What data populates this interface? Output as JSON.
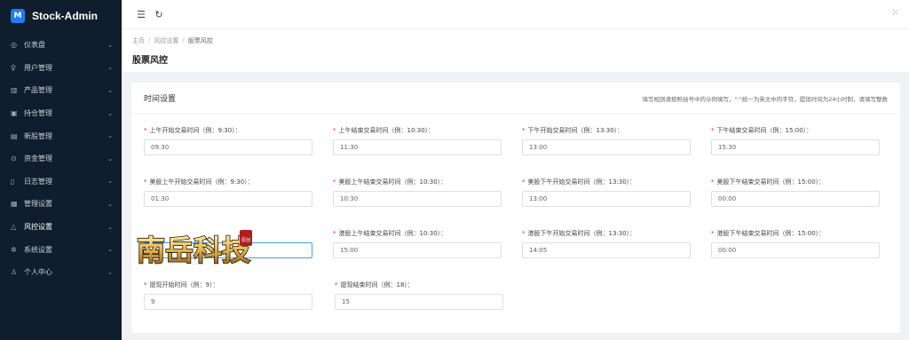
{
  "app": {
    "title": "Stock-Admin",
    "logo_glyph": "M"
  },
  "sidebar": {
    "items": [
      {
        "label": "仪表盘",
        "icon": "dashboard-icon",
        "glyph": "◎"
      },
      {
        "label": "用户管理",
        "icon": "users-icon",
        "glyph": "♀"
      },
      {
        "label": "产品管理",
        "icon": "chart-icon",
        "glyph": "▥"
      },
      {
        "label": "持仓管理",
        "icon": "position-icon",
        "glyph": "▣"
      },
      {
        "label": "新股管理",
        "icon": "ipo-icon",
        "glyph": "▤"
      },
      {
        "label": "资金管理",
        "icon": "fund-icon",
        "glyph": "⊙"
      },
      {
        "label": "日志管理",
        "icon": "log-icon",
        "glyph": "▯"
      },
      {
        "label": "管理设置",
        "icon": "admin-settings-icon",
        "glyph": "▦"
      },
      {
        "label": "风控设置",
        "icon": "risk-icon",
        "glyph": "△",
        "active": true
      },
      {
        "label": "系统设置",
        "icon": "gear-icon",
        "glyph": "✲"
      },
      {
        "label": "个人中心",
        "icon": "user-icon",
        "glyph": "♙"
      }
    ],
    "arrow_glyph": "⌄"
  },
  "topbar": {
    "collapse_glyph": "☰",
    "refresh_glyph": "↻",
    "right_glyph": "⁙"
  },
  "breadcrumb": {
    "home": "主页",
    "sep": "/",
    "parent": "风控设置",
    "current": "股票风控"
  },
  "page": {
    "title": "股票风控"
  },
  "card": {
    "title": "时间设置",
    "note": "填写规则请按照括号中的示例填写，\":\"统一为英文中的字符，提现时间为24小时制，请填写整数",
    "rows": [
      [
        {
          "label": "上午开始交易时间（例：9:30）：",
          "value": "09:30"
        },
        {
          "label": "上午结束交易时间（例：10:30）：",
          "value": "11:30"
        },
        {
          "label": "下午开始交易时间（例：13:30）：",
          "value": "13:00"
        },
        {
          "label": "下午结束交易时间（例：15:00）：",
          "value": "15:30"
        }
      ],
      [
        {
          "label": "美股上午开始交易时间（例：9:30）：",
          "value": "01:30"
        },
        {
          "label": "美股上午结束交易时间（例：10:30）：",
          "value": "10:30"
        },
        {
          "label": "美股下午开始交易时间（例：13:30）：",
          "value": "13:00"
        },
        {
          "label": "美股下午结束交易时间（例：15:00）：",
          "value": "00:00"
        }
      ],
      [
        {
          "label": "",
          "value": ""
        },
        {
          "label": "港股上午结束交易时间（例：10:30）：",
          "value": "15:00"
        },
        {
          "label": "港股下午开始交易时间（例：13:30）：",
          "value": "14:05"
        },
        {
          "label": "港股下午结束交易时间（例：15:00）：",
          "value": "00:00"
        }
      ],
      [
        {
          "label": "提现开始时间（例：9）：",
          "value": "9"
        },
        {
          "label": "提现结束时间（例：18）：",
          "value": "15"
        }
      ]
    ]
  },
  "watermark": {
    "text": "南岳科技",
    "seal": "原创"
  },
  "colors": {
    "sidebar_bg": "#0f1d2c",
    "accent": "#1d7cf2",
    "required": "#f5222d",
    "focus_border": "#409eff"
  }
}
